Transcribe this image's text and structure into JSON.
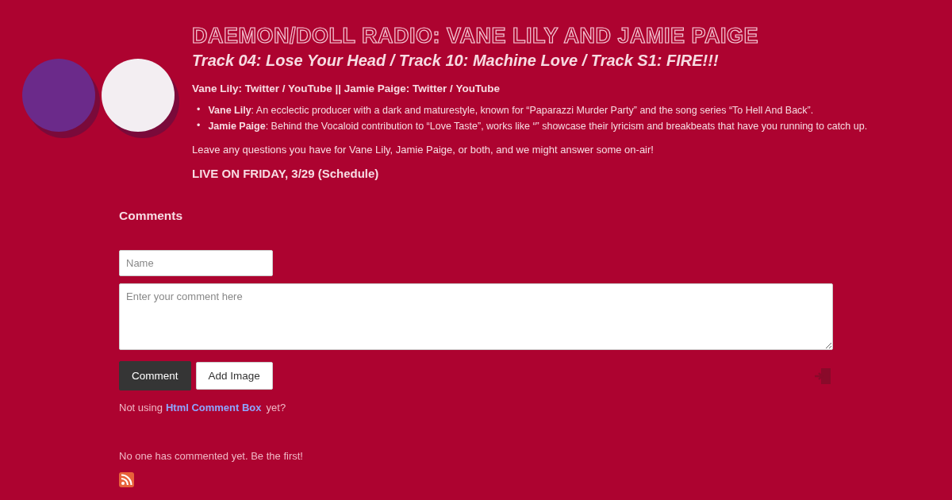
{
  "header": {
    "title": "DAEMON/DOLL RADIO: VANE LILY AND JAMIE PAIGE",
    "subtitle": "Track 04: Lose Your Head / Track 10: Machine Love / Track S1: FIRE!!!",
    "links": "Vane Lily: Twitter / YouTube || Jamie Paige: Twitter / YouTube"
  },
  "bullets": [
    {
      "marker": "•",
      "text": "**Vane Lily**: An ecclectic producer with a dark and maturestyle, known for “Paparazzi Murder Party” and the song series “To Hell And Back”."
    },
    {
      "marker": "•",
      "text": "**Jamie Paige**: Behind the Vocaloid contribution to “Love Taste”, works like “” showcase their lyricism and breakbeats that have you running to catch up."
    }
  ],
  "note": "Leave any questions you have for Vane Lily, Jamie Paige, or both, and we might answer some on-air!",
  "live": "LIVE ON FRIDAY, 3/29 (Schedule)",
  "comments": {
    "heading": "Comments",
    "name_placeholder": "Name",
    "comment_placeholder": "Enter your comment here",
    "buttons": [
      {
        "label": "Comment",
        "kind": "primary"
      },
      {
        "label": "Add Image",
        "kind": "secondary"
      }
    ],
    "promo_before": "Not using",
    "promo_link": "Html Comment Box",
    "promo_after": "yet?",
    "empty": "No one has commented yet. Be the first!"
  }
}
